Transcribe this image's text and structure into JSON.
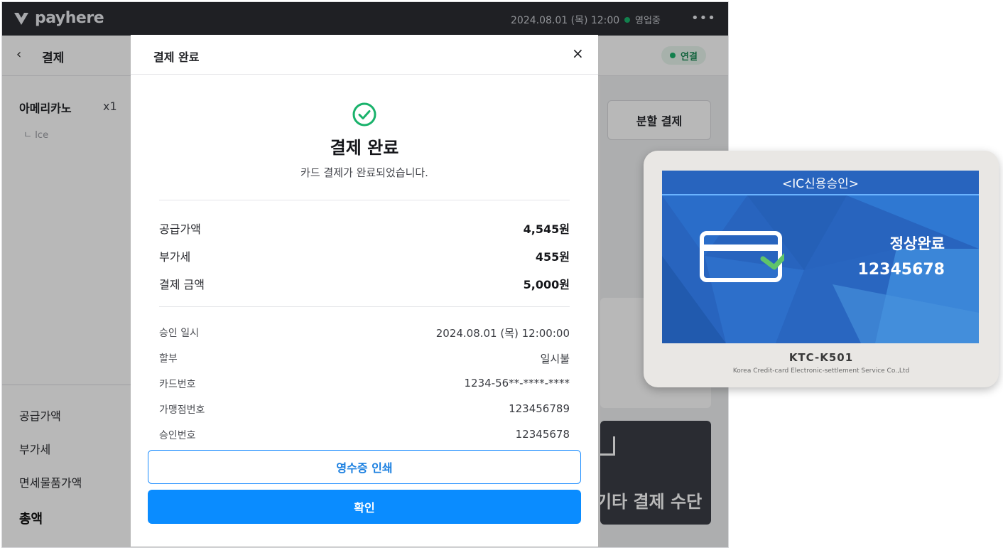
{
  "app": {
    "brand": "payhere",
    "datetime": "2024.08.01 (목) 12:00",
    "store_status": "영업중",
    "more": "•••",
    "back": "‹",
    "page_title": "결제",
    "connection_badge": "연결",
    "order_item": {
      "name": "아메리카노",
      "qty": "x1",
      "option": "ㄴ Ice"
    },
    "summary": {
      "supply": "공급가액",
      "vat": "부가세",
      "tax_free": "면세물품가액",
      "total": "총액"
    },
    "split_payment": "분할 결제",
    "other_payment": "기타 결제 수단"
  },
  "modal": {
    "header_title": "결제 완료",
    "close": "×",
    "title": "결제 완료",
    "subtitle": "카드 결제가 완료되었습니다.",
    "amounts": [
      {
        "label": "공급가액",
        "value": "4,545원"
      },
      {
        "label": "부가세",
        "value": "455원"
      },
      {
        "label": "결제 금액",
        "value": "5,000원"
      }
    ],
    "details": [
      {
        "label": "승인 일시",
        "value": "2024.08.01 (목) 12:00:00"
      },
      {
        "label": "할부",
        "value": "일시불"
      },
      {
        "label": "카드번호",
        "value": "1234-56**-****-****"
      },
      {
        "label": "가맹점번호",
        "value": "123456789"
      },
      {
        "label": "승인번호",
        "value": "12345678"
      }
    ],
    "print_button": "영수증 인쇄",
    "confirm_button": "확인"
  },
  "terminal": {
    "header": "<IC신용승인>",
    "status": "정상완료",
    "approval_number": "12345678",
    "model": "KTC-K501",
    "maker": "Korea Credit-card Electronic-settlement Service Co.,Ltd"
  },
  "colors": {
    "primary": "#0a8cff",
    "success": "#19b26b",
    "topbar": "#2b2d33",
    "terminal_screen": "#2864be"
  }
}
